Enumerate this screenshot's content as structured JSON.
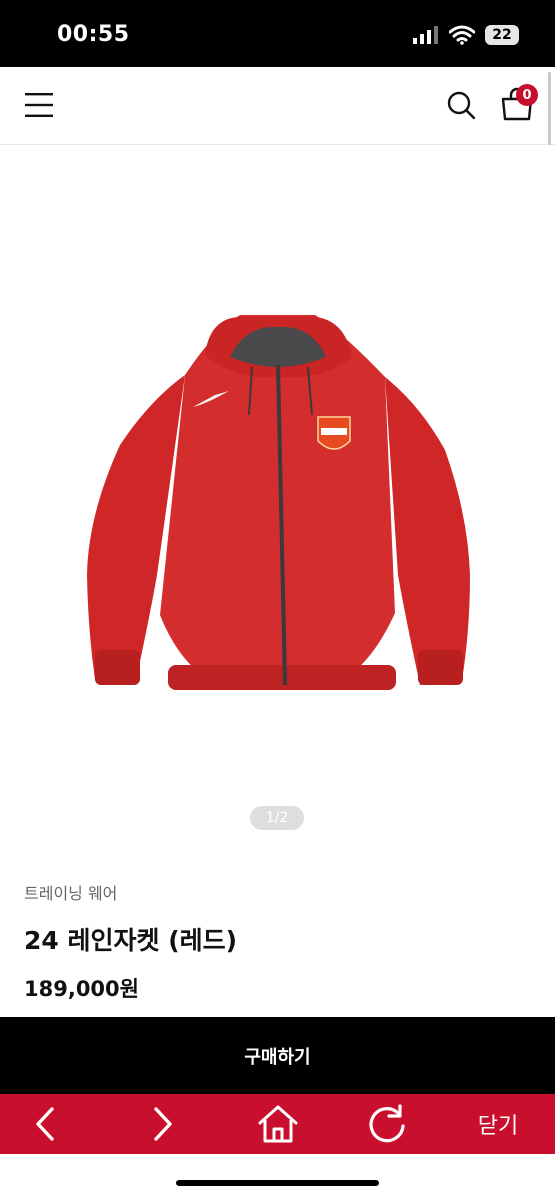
{
  "status_bar": {
    "time": "00:55",
    "battery": "22"
  },
  "header": {
    "cart_count": "0"
  },
  "gallery": {
    "pager": "1/2"
  },
  "product": {
    "category": "트레이닝 웨어",
    "title": "24 레인자켓 (레드)",
    "price": "189,000원"
  },
  "actions": {
    "buy_label": "구매하기"
  },
  "toolbar": {
    "close_label": "닫기"
  },
  "colors": {
    "accent": "#c8102e",
    "jacket": "#d42d2d",
    "dark": "#000000"
  },
  "icons": [
    "menu-icon",
    "search-icon",
    "cart-icon",
    "back-icon",
    "forward-icon",
    "home-icon",
    "refresh-icon",
    "wifi-icon",
    "signal-icon"
  ]
}
